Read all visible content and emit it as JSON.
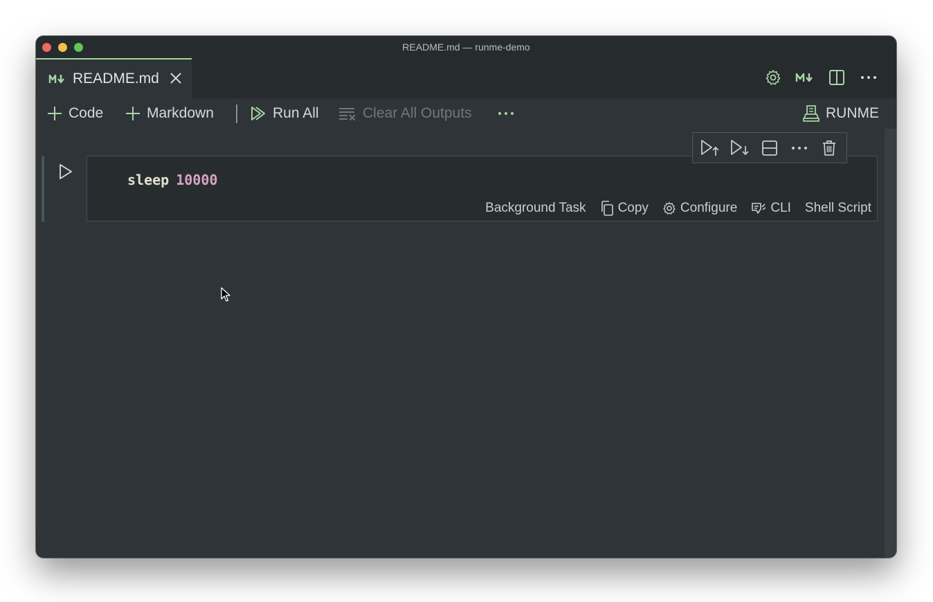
{
  "window": {
    "title": "README.md — runme-demo"
  },
  "tab": {
    "icon": "markdown-icon",
    "label": "README.md"
  },
  "tab_actions": [
    "gear-icon",
    "markdown-preview-icon",
    "split-editor-icon",
    "more-icon"
  ],
  "toolbar": {
    "add_code": "Code",
    "add_markdown": "Markdown",
    "run_all": "Run All",
    "clear_outputs": "Clear All Outputs",
    "runme": "RUNME"
  },
  "cell": {
    "command": "sleep",
    "argument": "10000",
    "status": {
      "background": "Background Task",
      "copy": "Copy",
      "configure": "Configure",
      "cli": "CLI",
      "lang": "Shell Script"
    }
  },
  "colors": {
    "accent": "#a9d4a5",
    "background": "#2e3437",
    "number": "#d8a2c4"
  }
}
